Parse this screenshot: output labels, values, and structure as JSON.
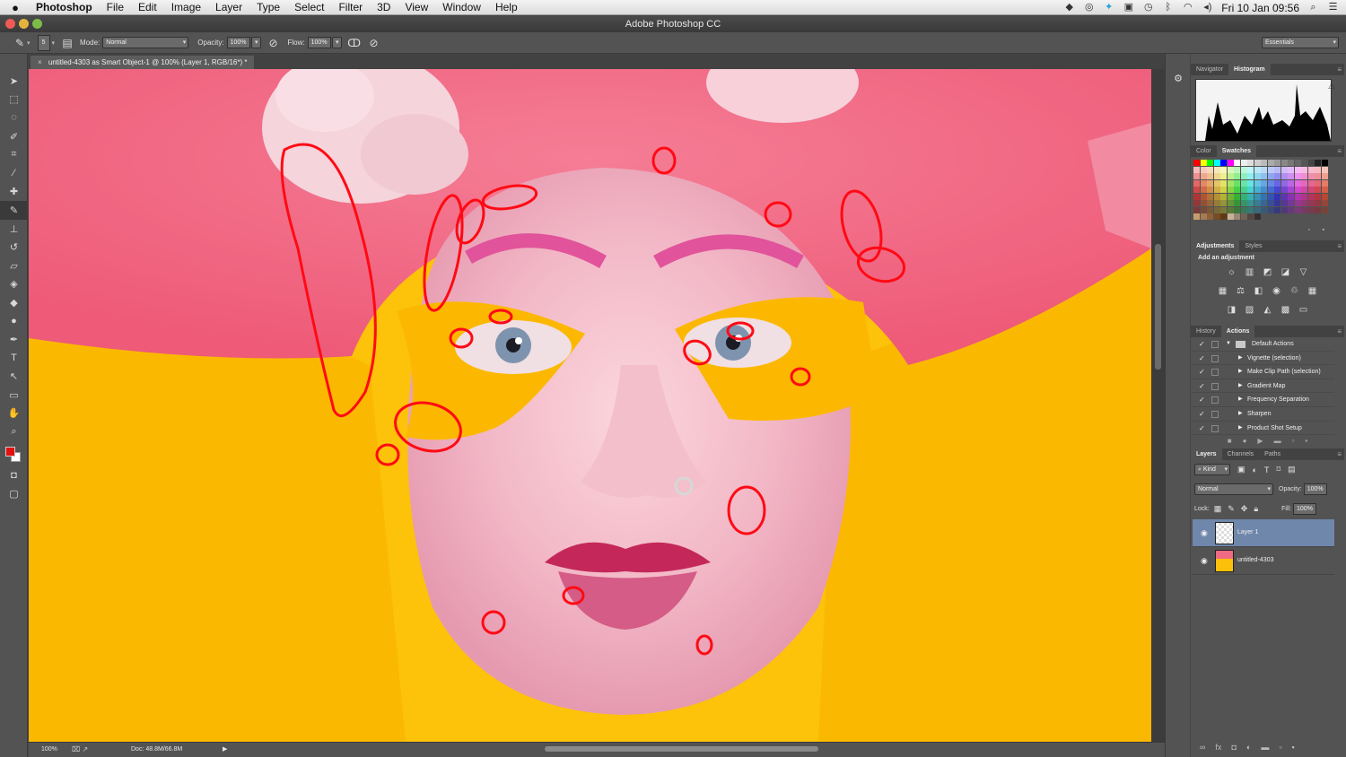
{
  "menubar": {
    "app": "Photoshop",
    "items": [
      "File",
      "Edit",
      "Image",
      "Layer",
      "Type",
      "Select",
      "Filter",
      "3D",
      "View",
      "Window",
      "Help"
    ],
    "clock": "Fri 10 Jan  09:56"
  },
  "titlebar": {
    "title": "Adobe Photoshop CC"
  },
  "options": {
    "brush_size": "5",
    "mode_label": "Mode:",
    "mode_value": "Normal",
    "opacity_label": "Opacity:",
    "opacity_value": "100%",
    "flow_label": "Flow:",
    "flow_value": "100%",
    "workspace": "Essentials"
  },
  "document": {
    "tab_title": "untitled-4303 as Smart Object-1 @ 100% (Layer 1, RGB/16*) *",
    "zoom": "100%",
    "doc_size": "Doc: 48.8M/66.8M"
  },
  "colors": {
    "foreground": "#e41010",
    "background": "#ffffff",
    "accent": "#6f87ab"
  },
  "panels": {
    "navigator_tabs": [
      "Navigator",
      "Histogram"
    ],
    "color_tabs": [
      "Color",
      "Swatches"
    ],
    "adjust_tabs": [
      "Adjustments",
      "Styles"
    ],
    "adjust_title": "Add an adjustment",
    "history_tabs": [
      "History",
      "Actions"
    ],
    "actions": [
      {
        "label": "Default Actions",
        "set": true
      },
      {
        "label": "Vignette (selection)",
        "set": false
      },
      {
        "label": "Make Clip Path (selection)",
        "set": false
      },
      {
        "label": "Gradient Map",
        "set": false
      },
      {
        "label": "Frequency Separation",
        "set": false
      },
      {
        "label": "Sharpen",
        "set": false
      },
      {
        "label": "Product Shot Setup",
        "set": false
      }
    ],
    "layers_tabs": [
      "Layers",
      "Channels",
      "Paths"
    ],
    "kind_label": "Kind",
    "blend_mode": "Normal",
    "opacity_label": "Opacity:",
    "opacity_value": "100%",
    "lock_label": "Lock:",
    "fill_label": "Fill:",
    "fill_value": "100%",
    "layers": [
      {
        "name": "Layer 1",
        "selected": true
      },
      {
        "name": "untitled-4303",
        "selected": false
      }
    ]
  },
  "icons": {
    "tools": [
      "move-tool-icon",
      "marquee-tool-icon",
      "lasso-tool-icon",
      "quick-select-tool-icon",
      "crop-tool-icon",
      "eyedropper-tool-icon",
      "healing-brush-tool-icon",
      "brush-tool-icon",
      "clone-stamp-tool-icon",
      "history-brush-tool-icon",
      "eraser-tool-icon",
      "paint-bucket-tool-icon",
      "blur-tool-icon",
      "dodge-tool-icon",
      "pen-tool-icon",
      "type-tool-icon",
      "path-select-tool-icon",
      "shape-tool-icon",
      "hand-tool-icon",
      "zoom-tool-icon"
    ]
  }
}
